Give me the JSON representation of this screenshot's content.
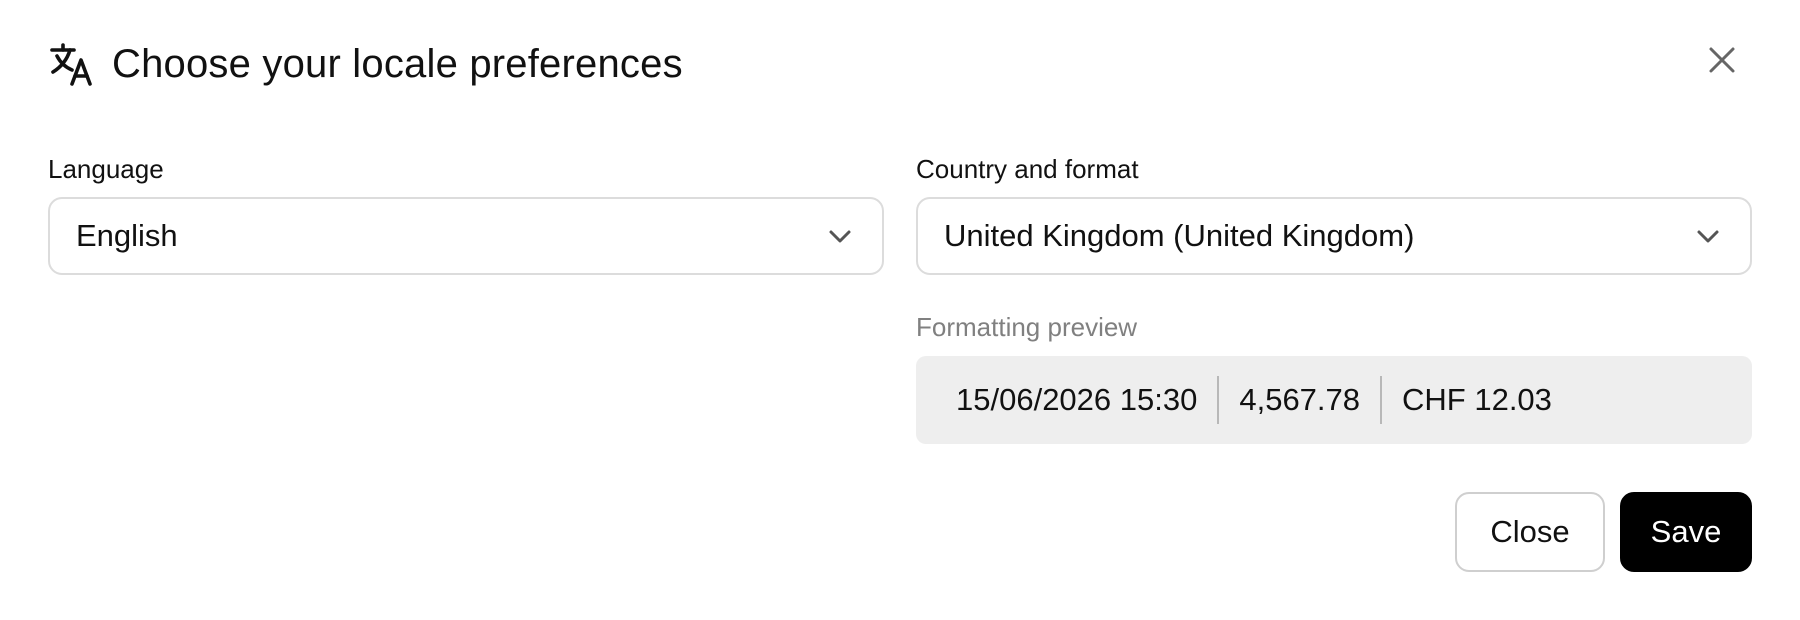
{
  "dialog": {
    "title": "Choose your locale preferences",
    "icons": {
      "title": "translate-icon",
      "close": "close-icon",
      "dropdown": "chevron-down-icon"
    }
  },
  "language": {
    "label": "Language",
    "selected": "English"
  },
  "country": {
    "label": "Country and format",
    "selected": "United Kingdom (United Kingdom)"
  },
  "preview": {
    "label": "Formatting preview",
    "items": [
      "15/06/2026 15:30",
      "4,567.78",
      "CHF 12.03"
    ]
  },
  "actions": {
    "close_label": "Close",
    "save_label": "Save"
  },
  "colors": {
    "primary_button_bg": "#000000",
    "primary_button_text": "#ffffff",
    "border": "#dcdcdc",
    "preview_bg": "#eeeeee",
    "muted_text": "#808080"
  }
}
